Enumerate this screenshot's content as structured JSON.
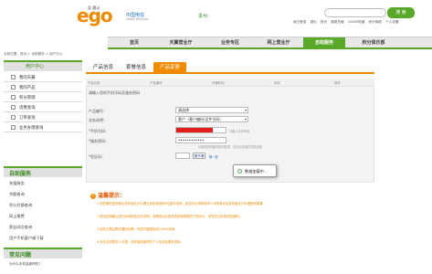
{
  "header": {
    "logo_text": "ego",
    "logo_sup": "爱·翼动",
    "carrier_name": "中国电信",
    "carrier_sub": "CHINA TELECOM",
    "city": "贵州",
    "search_button": "搜 索",
    "top_links": [
      "我已登录",
      "退出",
      "首页",
      "缴费充值",
      "10000知道",
      "积分商城",
      "个人设置"
    ]
  },
  "nav": {
    "items": [
      "首页",
      "天翼营业厅",
      "业务专区",
      "网上营业厅",
      "自助服务",
      "积分俱乐部"
    ],
    "active_index": 4
  },
  "breadcrumb": "当前位置：首页 > 自助服务 > 用户中心",
  "sidebar": {
    "title": "用户中心",
    "menu": [
      "我的天翼",
      "我的产品",
      "积分管理",
      "话费查询",
      "订单查询",
      "业务办理查询"
    ],
    "section_title": "自助服务",
    "sub_items": [
      "充值服务",
      "余额查询",
      "积分兑换查询",
      "网上缴费",
      "营业网点查询",
      "用户手机客户端下载"
    ],
    "faq_title": "常见问题",
    "faq_items": [
      "为什么手机会被停机？"
    ]
  },
  "main": {
    "tabs": [
      "产品信息",
      "套餐信息",
      "产品变更"
    ],
    "active_tab": 2,
    "columns": [
      "产品名称",
      "产品编号",
      "开通时间",
      "状态",
      "操作"
    ],
    "hint": "请输入您的手机号码及服务密码",
    "form": {
      "rows": [
        {
          "label": "产品编号：",
          "value": "请选择"
        },
        {
          "label": "业务选择：",
          "value": "客户（客户编码/证件号码）"
        },
        {
          "label": "*手机号码：",
          "value": ""
        },
        {
          "label": "*服务密码：",
          "value": "••••••••••••"
        },
        {
          "label": "*验证码：",
          "value": ""
        }
      ],
      "note_phone": "请输入手机号码",
      "note_pwd": "请使用您的服务密码登录，如忘记请通过短信找回",
      "captcha_text": "看不清",
      "captcha_link": "换一张"
    },
    "dialog_text": "数据加载中..."
  },
  "tips": {
    "title": "温馨提示：",
    "lines": [
      "1.您的服务密码即为您在营业厅办理业务时使用的6位数字密码，如您忘记请携带本人有效身份证件到营业厅办理密码重置。",
      "2.提交前请确认您已阅读相关业务说明，变更成功后相关资费将按新的产品执行，请您关注系统短信通知。",
      "3.如在办理过程中遇到问题，可拨打客服热线10000咨询。",
      "4.本业务仅限本人办理，请妥善保管您的个人信息及服务密码。"
    ]
  },
  "colors": {
    "brand_green": "#5aa82a",
    "accent_orange": "#f08a00",
    "alert_red": "#e11d1d"
  }
}
